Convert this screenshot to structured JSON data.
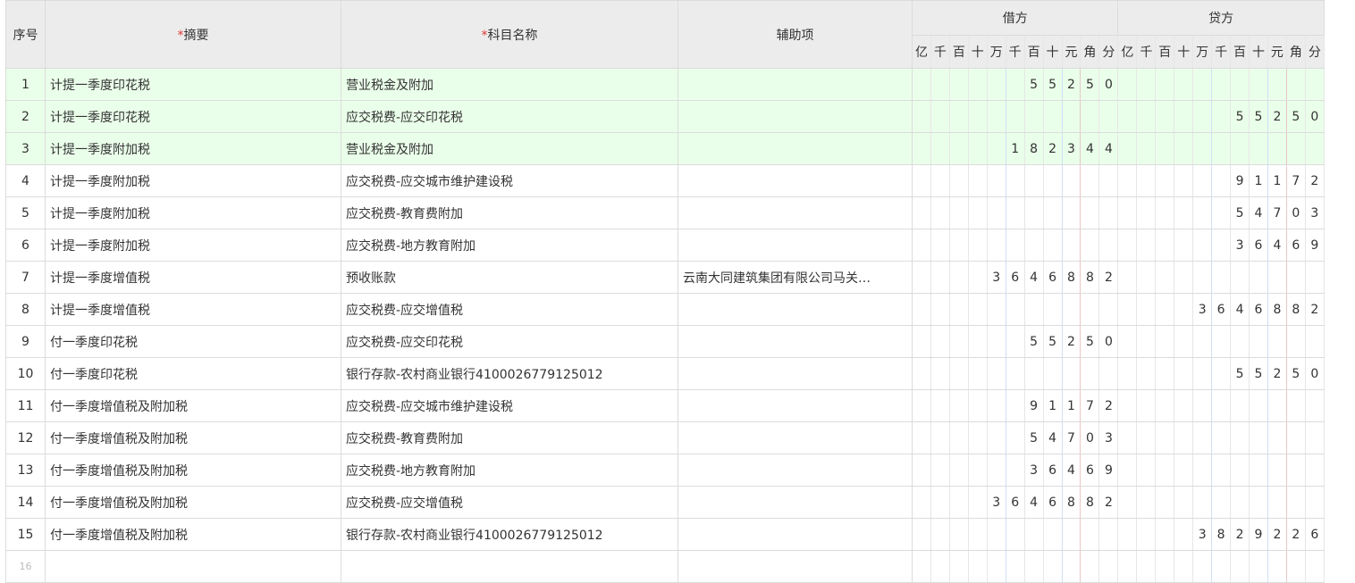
{
  "header": {
    "index": "序号",
    "summary": "摘要",
    "account": "科目名称",
    "auxiliary": "辅助项",
    "debit": "借方",
    "credit": "贷方",
    "required_mark": "*",
    "digits": [
      "亿",
      "千",
      "百",
      "十",
      "万",
      "千",
      "百",
      "十",
      "元",
      "角",
      "分"
    ]
  },
  "rows": [
    {
      "idx": "1",
      "summary": "计提一季度印花税",
      "account": "营业税金及附加",
      "aux": "",
      "debit": "5525 0",
      "credit": "",
      "hl": true
    },
    {
      "idx": "2",
      "summary": "计提一季度印花税",
      "account": "应交税费-应交印花税",
      "aux": "",
      "debit": "",
      "credit": "55250",
      "hl": true
    },
    {
      "idx": "3",
      "summary": "计提一季度附加税",
      "account": "营业税金及附加",
      "aux": "",
      "debit": "182344",
      "credit": "",
      "hl": true
    },
    {
      "idx": "4",
      "summary": "计提一季度附加税",
      "account": "应交税费-应交城市维护建设税",
      "aux": "",
      "debit": "",
      "credit": "91172",
      "hl": false
    },
    {
      "idx": "5",
      "summary": "计提一季度附加税",
      "account": "应交税费-教育费附加",
      "aux": "",
      "debit": "",
      "credit": "54703",
      "hl": false
    },
    {
      "idx": "6",
      "summary": "计提一季度附加税",
      "account": "应交税费-地方教育附加",
      "aux": "",
      "debit": "",
      "credit": "36469",
      "hl": false
    },
    {
      "idx": "7",
      "summary": "计提一季度增值税",
      "account": "预收账款",
      "aux": "云南大同建筑集团有限公司马关…",
      "debit": "3646882",
      "credit": "",
      "hl": false
    },
    {
      "idx": "8",
      "summary": "计提一季度增值税",
      "account": "应交税费-应交增值税",
      "aux": "",
      "debit": "",
      "credit": "3646882",
      "hl": false
    },
    {
      "idx": "9",
      "summary": "付一季度印花税",
      "account": "应交税费-应交印花税",
      "aux": "",
      "debit": "55250",
      "credit": "",
      "hl": false
    },
    {
      "idx": "10",
      "summary": "付一季度印花税",
      "account": "银行存款-农村商业银行4100026779125012",
      "aux": "",
      "debit": "",
      "credit": "55250",
      "hl": false
    },
    {
      "idx": "11",
      "summary": "付一季度增值税及附加税",
      "account": "应交税费-应交城市维护建设税",
      "aux": "",
      "debit": "91172",
      "credit": "",
      "hl": false
    },
    {
      "idx": "12",
      "summary": "付一季度增值税及附加税",
      "account": "应交税费-教育费附加",
      "aux": "",
      "debit": "54703",
      "credit": "",
      "hl": false
    },
    {
      "idx": "13",
      "summary": "付一季度增值税及附加税",
      "account": "应交税费-地方教育附加",
      "aux": "",
      "debit": "36469",
      "credit": "",
      "hl": false
    },
    {
      "idx": "14",
      "summary": "付一季度增值税及附加税",
      "account": "应交税费-应交增值税",
      "aux": "",
      "debit": "3646882",
      "credit": "",
      "hl": false
    },
    {
      "idx": "15",
      "summary": "付一季度增值税及附加税",
      "account": "银行存款-农村商业银行4100026779125012",
      "aux": "",
      "debit": "",
      "credit": "3829226",
      "hl": false
    },
    {
      "idx": "16",
      "summary": "",
      "account": "",
      "aux": "",
      "debit": "",
      "credit": "",
      "hl": false
    }
  ]
}
